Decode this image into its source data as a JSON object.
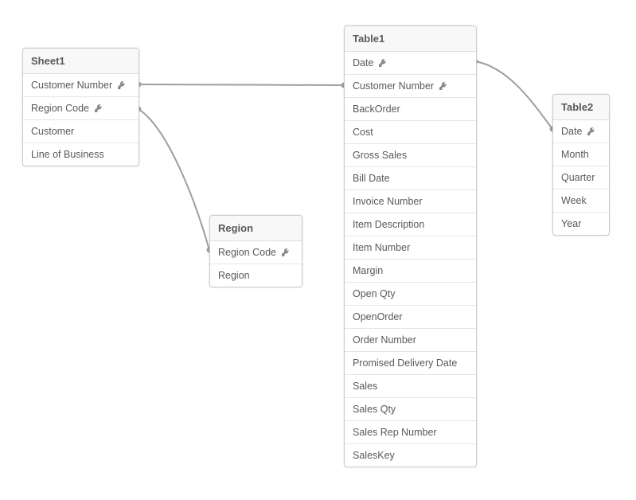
{
  "tables": {
    "sheet1": {
      "name": "Sheet1",
      "fields": [
        {
          "name": "Customer Number",
          "key": true
        },
        {
          "name": "Region Code",
          "key": true
        },
        {
          "name": "Customer",
          "key": false
        },
        {
          "name": "Line of Business",
          "key": false
        }
      ]
    },
    "region": {
      "name": "Region",
      "fields": [
        {
          "name": "Region Code",
          "key": true
        },
        {
          "name": "Region",
          "key": false
        }
      ]
    },
    "table1": {
      "name": "Table1",
      "fields": [
        {
          "name": "Date",
          "key": true
        },
        {
          "name": "Customer Number",
          "key": true
        },
        {
          "name": "BackOrder",
          "key": false
        },
        {
          "name": "Cost",
          "key": false
        },
        {
          "name": "Gross Sales",
          "key": false
        },
        {
          "name": "Bill Date",
          "key": false
        },
        {
          "name": "Invoice Number",
          "key": false
        },
        {
          "name": "Item Description",
          "key": false
        },
        {
          "name": "Item Number",
          "key": false
        },
        {
          "name": "Margin",
          "key": false
        },
        {
          "name": "Open Qty",
          "key": false
        },
        {
          "name": "OpenOrder",
          "key": false
        },
        {
          "name": "Order Number",
          "key": false
        },
        {
          "name": "Promised Delivery Date",
          "key": false
        },
        {
          "name": "Sales",
          "key": false
        },
        {
          "name": "Sales Qty",
          "key": false
        },
        {
          "name": "Sales Rep Number",
          "key": false
        },
        {
          "name": "SalesKey",
          "key": false
        }
      ]
    },
    "table2": {
      "name": "Table2",
      "fields": [
        {
          "name": "Date",
          "key": true
        },
        {
          "name": "Month",
          "key": false
        },
        {
          "name": "Quarter",
          "key": false
        },
        {
          "name": "Week",
          "key": false
        },
        {
          "name": "Year",
          "key": false
        }
      ]
    }
  },
  "associations": [
    {
      "from": "sheet1.Customer Number",
      "to": "table1.Customer Number"
    },
    {
      "from": "sheet1.Region Code",
      "to": "region.Region Code"
    },
    {
      "from": "table1.Date",
      "to": "table2.Date"
    }
  ]
}
